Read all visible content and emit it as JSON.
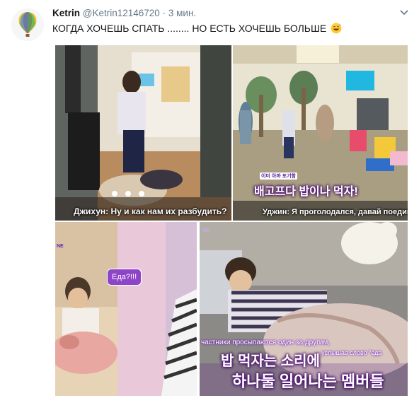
{
  "tweet": {
    "name": "Ketrin",
    "handle": "@Ketrin12146720",
    "dot": "·",
    "time": "3 мин.",
    "text": "КОГДА ХОЧЕШЬ СПАТЬ ........ НО ЕСТЬ ХОЧЕШЬ БОЛЬШЕ",
    "emoji": "grinning-sweat-emoji"
  },
  "panels": {
    "p1": {
      "caption": "Джихун: Ну и как нам их разбудить?"
    },
    "p2": {
      "korean_small": "이미 아까 포기함",
      "korean_main": "배고프다 밥이나 먹자!",
      "caption": "Уджин: Я проголодался, давай поедим."
    },
    "p3": {
      "bubble": "Еда?!!!"
    },
    "p4": {
      "russian_top": "частники просыпаются один за другим,",
      "russian_side": "услышав слово \"еда",
      "korean_line1": "밥 먹자는 소리에",
      "korean_line2": "하나둘 일어나는 멤버들"
    }
  },
  "colors": {
    "accent": "#8e44c9",
    "text": "#14171a",
    "muted": "#657786"
  }
}
